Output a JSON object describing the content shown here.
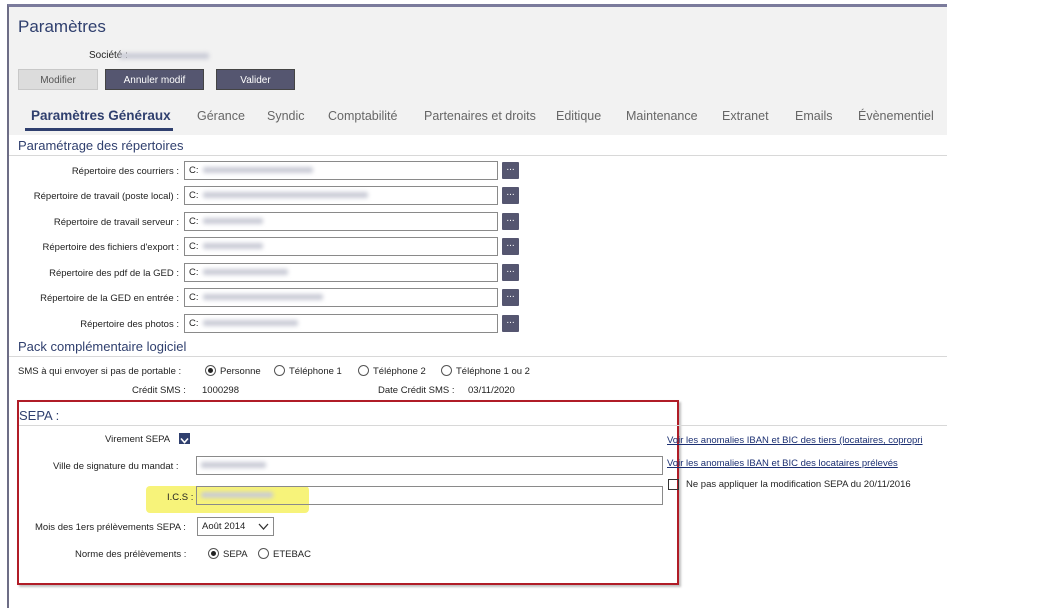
{
  "page": {
    "title": "Paramètres",
    "societe_label": "Société :",
    "buttons": {
      "modifier": "Modifier",
      "annuler": "Annuler modif",
      "valider": "Valider"
    }
  },
  "tabs": [
    "Paramètres Généraux",
    "Gérance",
    "Syndic",
    "Comptabilité",
    "Partenaires et droits",
    "Editique",
    "Maintenance",
    "Extranet",
    "Emails",
    "Évènementiel"
  ],
  "repertoires": {
    "title": "Paramétrage des répertoires",
    "rows": [
      {
        "label": "Répertoire des courriers :",
        "value": "C:"
      },
      {
        "label": "Répertoire de travail (poste local) :",
        "value": "C:"
      },
      {
        "label": "Répertoire de travail serveur :",
        "value": "C:"
      },
      {
        "label": "Répertoire des fichiers d'export :",
        "value": "C:"
      },
      {
        "label": "Répertoire des pdf de la GED :",
        "value": "C:"
      },
      {
        "label": "Répertoire de la GED en entrée :",
        "value": "C:"
      },
      {
        "label": "Répertoire des photos :",
        "value": "C:"
      }
    ],
    "browse_label": "..."
  },
  "pack": {
    "title": "Pack complémentaire logiciel",
    "sms_label": "SMS à qui envoyer si pas de portable :",
    "sms_options": [
      "Personne",
      "Téléphone 1",
      "Téléphone 2",
      "Téléphone 1 ou 2"
    ],
    "sms_selected": "Personne",
    "credit_label": "Crédit SMS :",
    "credit_value": "1000298",
    "date_label": "Date Crédit SMS :",
    "date_value": "03/11/2020"
  },
  "sepa": {
    "title": "SEPA :",
    "virement_label": "Virement SEPA",
    "virement_checked": true,
    "ville_label": "Ville de signature du mandat :",
    "ics_label": "I.C.S :",
    "mois_label": "Mois des 1ers prélèvements SEPA :",
    "mois_value": "Août 2014",
    "norme_label": "Norme des prélèvements :",
    "norme_options": [
      "SEPA",
      "ETEBAC"
    ],
    "norme_selected": "SEPA",
    "link1": "Voir les anomalies IBAN et BIC des tiers (locataires, copropri",
    "link2": "Voir les anomalies IBAN et BIC des locataires prélevés",
    "ne_pas_label": "Ne pas appliquer la modification SEPA du 20/11/2016",
    "ne_pas_checked": false
  },
  "colors": {
    "accent": "#555670",
    "title": "#2f3f6e",
    "sepa_border": "#b01c27",
    "highlight": "#f7f37a"
  }
}
